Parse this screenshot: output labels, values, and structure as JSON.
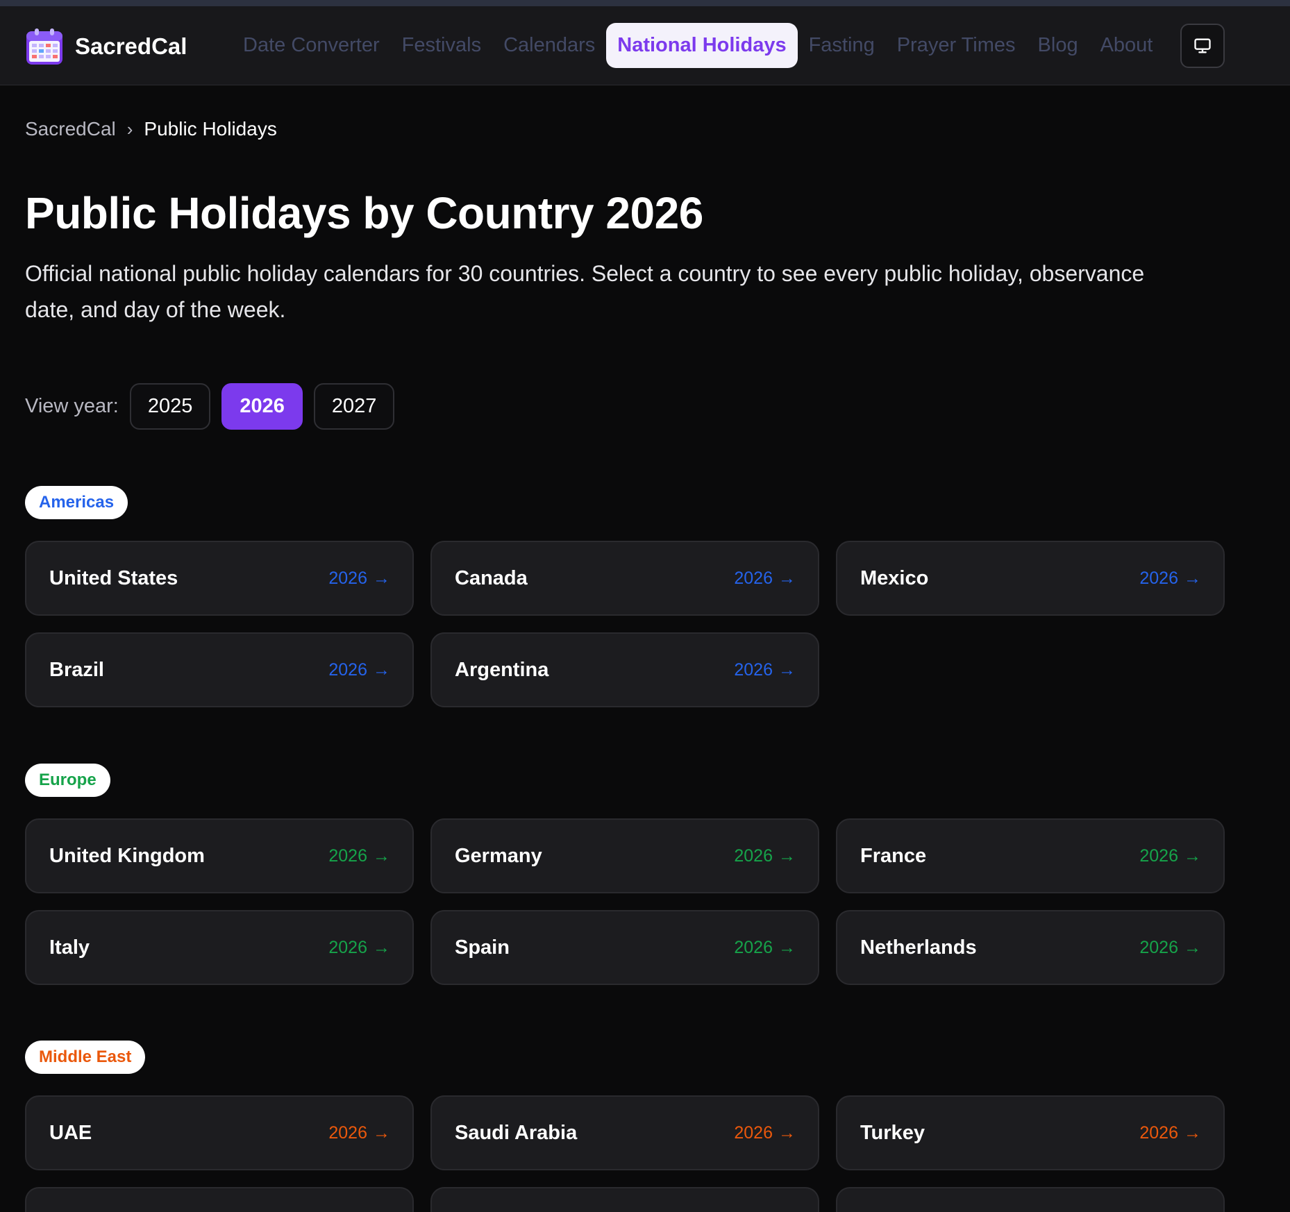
{
  "app": {
    "brand": "SacredCal",
    "colors": {
      "accent": "#7c3aed",
      "americas": "#2563eb",
      "europe": "#16a34a",
      "middle_east": "#ea580c"
    }
  },
  "nav": {
    "items": [
      {
        "label": "Date Converter"
      },
      {
        "label": "Festivals"
      },
      {
        "label": "Calendars"
      },
      {
        "label": "National Holidays",
        "active": true
      },
      {
        "label": "Fasting"
      },
      {
        "label": "Prayer Times"
      },
      {
        "label": "Blog"
      },
      {
        "label": "About"
      }
    ],
    "theme_icon": "monitor-icon"
  },
  "breadcrumb": {
    "home": "SacredCal",
    "separator": "›",
    "current": "Public Holidays"
  },
  "page": {
    "title": "Public Holidays by Country 2026",
    "description": "Official national public holiday calendars for 30 countries. Select a country to see every public holiday, observance date, and day of the week."
  },
  "year_selector": {
    "label": "View year:",
    "years": [
      "2025",
      "2026",
      "2027"
    ],
    "selected": "2026"
  },
  "regions": [
    {
      "name": "Americas",
      "countries": [
        {
          "name": "United States",
          "year": "2026",
          "arrow": "→"
        },
        {
          "name": "Canada",
          "year": "2026",
          "arrow": "→"
        },
        {
          "name": "Mexico",
          "year": "2026",
          "arrow": "→"
        },
        {
          "name": "Brazil",
          "year": "2026",
          "arrow": "→"
        },
        {
          "name": "Argentina",
          "year": "2026",
          "arrow": "→"
        }
      ]
    },
    {
      "name": "Europe",
      "countries": [
        {
          "name": "United Kingdom",
          "year": "2026",
          "arrow": "→"
        },
        {
          "name": "Germany",
          "year": "2026",
          "arrow": "→"
        },
        {
          "name": "France",
          "year": "2026",
          "arrow": "→"
        },
        {
          "name": "Italy",
          "year": "2026",
          "arrow": "→"
        },
        {
          "name": "Spain",
          "year": "2026",
          "arrow": "→"
        },
        {
          "name": "Netherlands",
          "year": "2026",
          "arrow": "→"
        }
      ]
    },
    {
      "name": "Middle East",
      "countries": [
        {
          "name": "UAE",
          "year": "2026",
          "arrow": "→"
        },
        {
          "name": "Saudi Arabia",
          "year": "2026",
          "arrow": "→"
        },
        {
          "name": "Turkey",
          "year": "2026",
          "arrow": "→"
        }
      ]
    }
  ]
}
